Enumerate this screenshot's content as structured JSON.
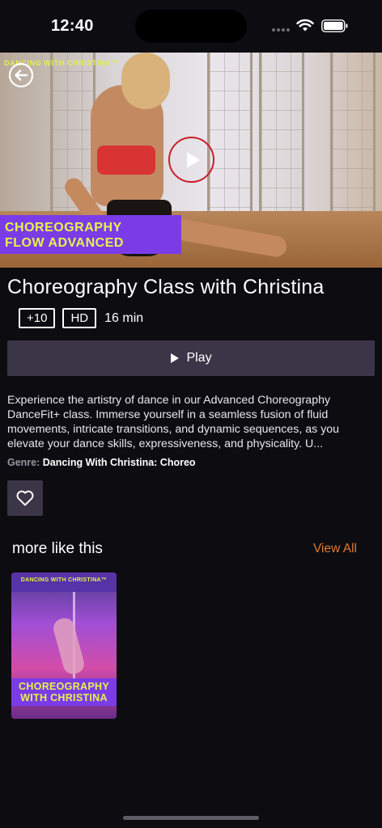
{
  "status_bar": {
    "time": "12:40"
  },
  "hero": {
    "brand_text": "DANCING WITH CHRISTINA™",
    "banner_line1": "CHOREOGRAPHY",
    "banner_line2": "FLOW ADVANCED",
    "play_ring_color": "#c8202a",
    "banner_color": "#7b3ce8",
    "banner_text_color": "#e6f24a"
  },
  "detail": {
    "title": "Choreography Class with Christina",
    "age_rating": "+10",
    "quality": "HD",
    "duration": "16 min",
    "play_label": "Play",
    "description": "Experience the artistry of dance in our Advanced Choreography DanceFit+ class. Immerse yourself in a seamless fusion of fluid movements, intricate transitions, and dynamic sequences, as you elevate your dance skills, expressiveness, and physicality. U...",
    "genre_label": "Genre:",
    "genre_value": "Dancing With Christina: Choreo"
  },
  "more": {
    "section_title": "more like this",
    "view_all_label": "View All",
    "view_all_color": "#e07a2e",
    "items": [
      {
        "brand_text": "DANCING WITH CHRISTINA™",
        "banner_line1": "CHOREOGRAPHY",
        "banner_line2": "WITH CHRISTINA"
      }
    ]
  },
  "icons": [
    "back-arrow-icon",
    "play-icon",
    "heart-icon",
    "wifi-icon",
    "battery-icon"
  ]
}
